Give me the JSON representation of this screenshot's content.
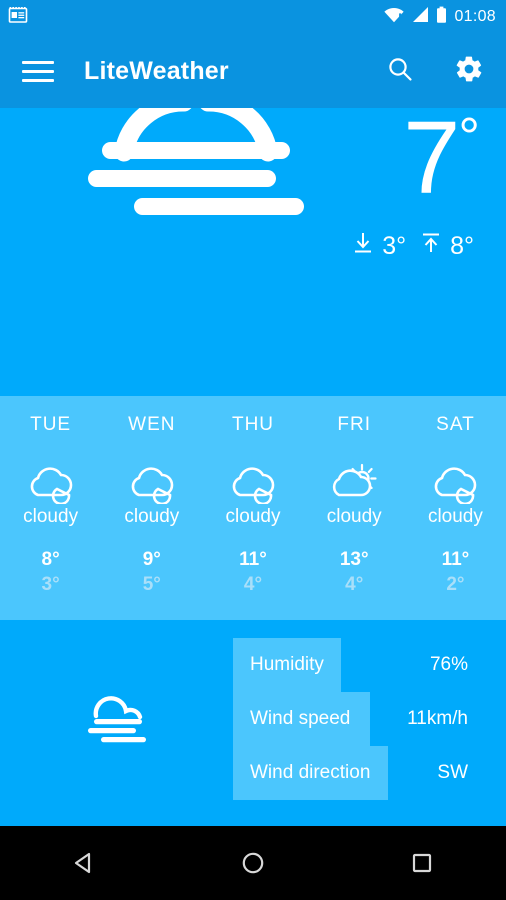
{
  "statusbar": {
    "notification_icon": "news-icon",
    "wifi_icon": "wifi-warning-icon",
    "signal_icon": "cellular-signal-icon",
    "battery_icon": "battery-icon",
    "time": "01:08"
  },
  "appbar": {
    "menu_icon": "hamburger-menu-icon",
    "title": "LiteWeather",
    "search_icon": "search-icon",
    "settings_icon": "gear-icon"
  },
  "hero": {
    "condition_icon": "fog-icon",
    "temperature": "7",
    "degree": "°",
    "min_icon": "arrow-down-to-line-icon",
    "min_temp": "3°",
    "max_icon": "arrow-up-to-line-icon",
    "max_temp": "8°"
  },
  "forecast": [
    {
      "day": "TUE",
      "icon": "cloudy-icon",
      "desc": "cloudy",
      "high": "8°",
      "low": "3°"
    },
    {
      "day": "WEN",
      "icon": "cloudy-icon",
      "desc": "cloudy",
      "high": "9°",
      "low": "5°"
    },
    {
      "day": "THU",
      "icon": "cloudy-icon",
      "desc": "cloudy",
      "high": "11°",
      "low": "4°"
    },
    {
      "day": "FRI",
      "icon": "partly-sunny-icon",
      "desc": "cloudy",
      "high": "13°",
      "low": "4°"
    },
    {
      "day": "SAT",
      "icon": "cloudy-icon",
      "desc": "cloudy",
      "high": "11°",
      "low": "2°"
    }
  ],
  "details": {
    "condition_icon": "fog-icon",
    "rows": [
      {
        "label": "Humidity",
        "value": "76%"
      },
      {
        "label": "Wind speed",
        "value": "11km/h"
      },
      {
        "label": "Wind direction",
        "value": "SW"
      }
    ]
  },
  "navbar": {
    "back_icon": "back-triangle-icon",
    "home_icon": "home-circle-icon",
    "recents_icon": "recents-square-icon"
  },
  "colors": {
    "appbar": "#0A93E0",
    "hero_bg": "#00AAFB",
    "forecast_bg": "#4BC6FD",
    "details_bg": "#00AAFB",
    "label_highlight": "#4BC6FD",
    "low_temp": "#A9DFF9",
    "navbar": "#000000",
    "text": "#FFFFFF"
  }
}
